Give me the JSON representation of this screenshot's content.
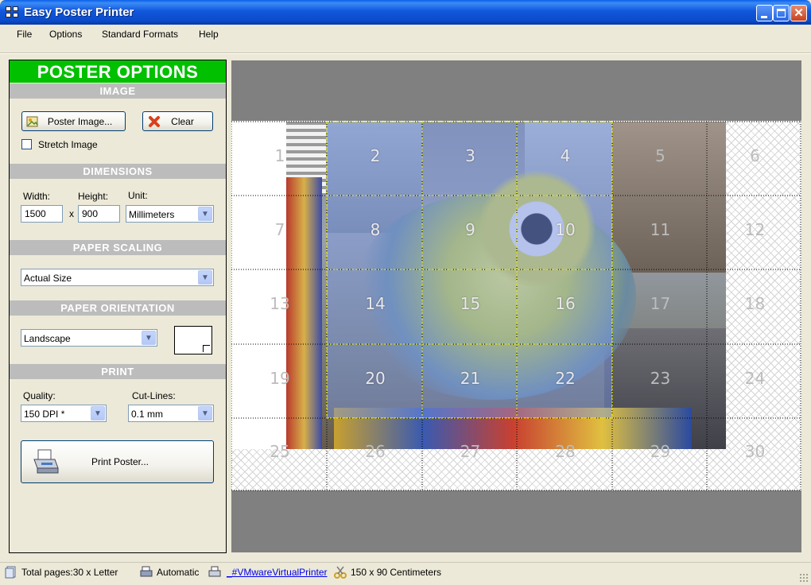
{
  "window": {
    "title": "Easy Poster Printer"
  },
  "menu": [
    "File",
    "Options",
    "Standard Formats",
    "Help"
  ],
  "panel": {
    "header": "POSTER OPTIONS",
    "image": {
      "section": "IMAGE",
      "poster_image_button": "Poster Image...",
      "clear_button": "Clear",
      "stretch_label": "Stretch Image",
      "stretch_checked": false
    },
    "dimensions": {
      "section": "DIMENSIONS",
      "width_label": "Width:",
      "height_label": "Height:",
      "unit_label": "Unit:",
      "width_value": "1500",
      "height_value": "900",
      "times": "x",
      "unit_value": "Millimeters"
    },
    "paper_scaling": {
      "section": "PAPER SCALING",
      "value": "Actual Size"
    },
    "paper_orientation": {
      "section": "PAPER ORIENTATION",
      "value": "Landscape"
    },
    "print": {
      "section": "PRINT",
      "quality_label": "Quality:",
      "quality_value": "150 DPI *",
      "cutlines_label": "Cut-Lines:",
      "cutlines_value": "0.1 mm",
      "print_button": "Print Poster..."
    }
  },
  "preview": {
    "tiles": [
      "1",
      "2",
      "3",
      "4",
      "5",
      "6",
      "7",
      "8",
      "9",
      "10",
      "11",
      "12",
      "13",
      "14",
      "15",
      "16",
      "17",
      "18",
      "19",
      "20",
      "21",
      "22",
      "23",
      "24",
      "25",
      "26",
      "27",
      "28",
      "29",
      "30"
    ],
    "highlighted_tiles": [
      2,
      3,
      4,
      8,
      9,
      10,
      14,
      15,
      16,
      20,
      21,
      22
    ]
  },
  "status": {
    "pages": "Total pages:30 x Letter",
    "mode": "Automatic",
    "printer": "_#VMwareVirtualPrinter",
    "size": "150 x 90 Centimeters"
  },
  "colors": {
    "header_green": "#00c000",
    "section_gray": "#bcbcbc",
    "preview_gray": "#808080",
    "overlay_blue": "#7896e6",
    "cut_yellow": "#e8e800"
  }
}
